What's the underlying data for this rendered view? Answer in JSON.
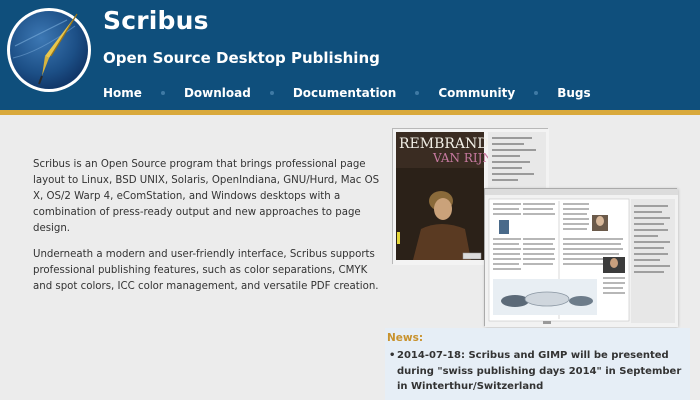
{
  "header": {
    "title": "Scribus",
    "tagline": "Open Source Desktop Publishing",
    "nav": [
      "Home",
      "Download",
      "Documentation",
      "Community",
      "Bugs"
    ],
    "colors": {
      "bar": "#0f4f7c",
      "rule": "#d9a93c",
      "accent": "#c8922d"
    },
    "logo_icon": "quill-pen-icon"
  },
  "intro": {
    "paragraphs": [
      "Scribus is an Open Source program that brings professional page layout to Linux, BSD UNIX, Solaris, OpenIndiana, GNU/Hurd, Mac OS X, OS/2 Warp 4, eComStation, and Windows desktops with a combination of press-ready output and new approaches to page design.",
      "Underneath a modern and user-friendly interface, Scribus supports professional publishing features, such as color separations, CMYK and spot colors, ICC color management, and versatile PDF creation."
    ]
  },
  "screenshot": {
    "cover_title_1": "REMBRANDT",
    "cover_title_2": "VAN RIJN"
  },
  "news": {
    "title": "News:",
    "items": [
      "2014-07-18: Scribus and GIMP will be presented during \"swiss publishing days 2014\" in September in Winterthur/Switzerland"
    ]
  }
}
